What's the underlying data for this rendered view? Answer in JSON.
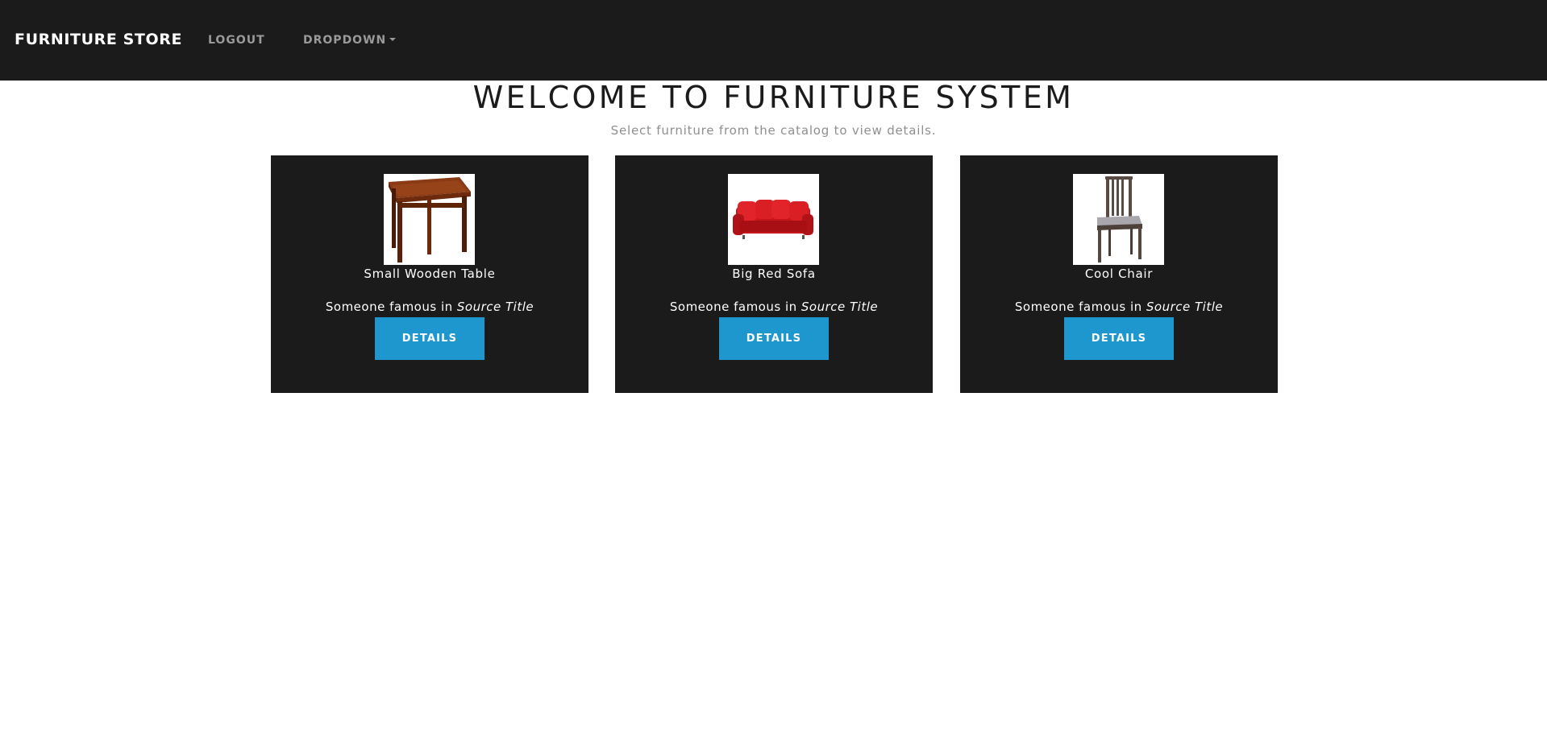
{
  "navbar": {
    "brand": "FURNITURE STORE",
    "links": [
      {
        "label": "LOGOUT"
      },
      {
        "label": "DROPDOWN"
      }
    ]
  },
  "header": {
    "title": "WELCOME TO FURNITURE SYSTEM",
    "subtitle": "Select furniture from the catalog to view details."
  },
  "catalog": {
    "items": [
      {
        "name": "Small Wooden Table",
        "quote_text": "Someone famous in ",
        "quote_source": "Source Title",
        "button_label": "DETAILS",
        "image_icon": "wooden-table-image"
      },
      {
        "name": "Big Red Sofa",
        "quote_text": "Someone famous in ",
        "quote_source": "Source Title",
        "button_label": "DETAILS",
        "image_icon": "red-sofa-image"
      },
      {
        "name": "Cool Chair",
        "quote_text": "Someone famous in ",
        "quote_source": "Source Title",
        "button_label": "DETAILS",
        "image_icon": "chair-image"
      }
    ]
  },
  "colors": {
    "navbar_bg": "#1b1b1b",
    "card_bg": "#1b1b1b",
    "button_bg": "#1e97cf",
    "nav_link": "#9a9a9a",
    "subtitle": "#8f8f8f"
  }
}
